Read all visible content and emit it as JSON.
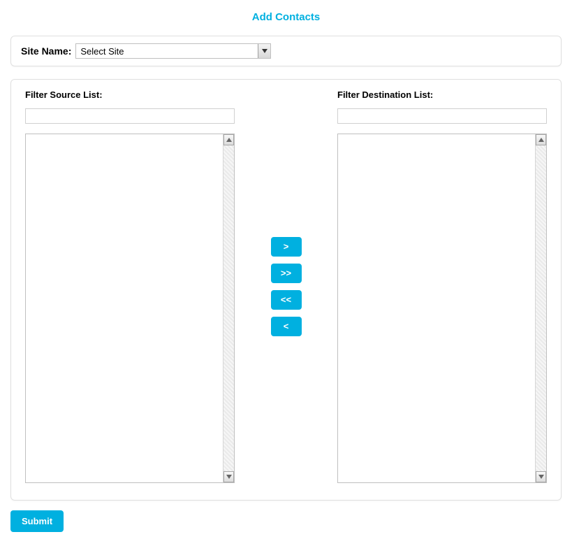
{
  "title": "Add Contacts",
  "site": {
    "label": "Site Name:",
    "selected": "Select Site"
  },
  "source": {
    "label": "Filter Source List:",
    "filter_value": ""
  },
  "destination": {
    "label": "Filter Destination List:",
    "filter_value": ""
  },
  "buttons": {
    "move_right": ">",
    "move_all_right": ">>",
    "move_all_left": "<<",
    "move_left": "<",
    "submit": "Submit"
  }
}
